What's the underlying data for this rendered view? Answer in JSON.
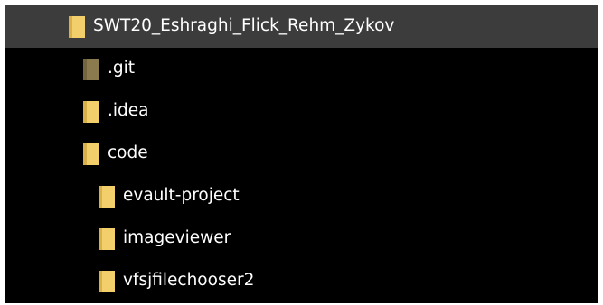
{
  "tree": {
    "items": [
      {
        "label": "SWT20_Eshraghi_Flick_Rehm_Zykov",
        "icon": "folder-icon",
        "level": 0,
        "selected": true
      },
      {
        "label": ".git",
        "icon": "folder-hidden-icon",
        "level": 1,
        "selected": false
      },
      {
        "label": ".idea",
        "icon": "folder-icon",
        "level": 1,
        "selected": false
      },
      {
        "label": "code",
        "icon": "folder-icon",
        "level": 1,
        "selected": false
      },
      {
        "label": "evault-project",
        "icon": "folder-icon",
        "level": 2,
        "selected": false
      },
      {
        "label": "imageviewer",
        "icon": "folder-icon",
        "level": 2,
        "selected": false
      },
      {
        "label": "vfsjfilechooser2",
        "icon": "folder-icon",
        "level": 2,
        "selected": false
      }
    ]
  },
  "colors": {
    "background": "#000000",
    "selected_row": "#3c3c3c",
    "text": "#ffffff",
    "folder": "#f3cf6b",
    "folder_dark": "#d9b04a",
    "folder_hidden": "#8a7a4e"
  }
}
